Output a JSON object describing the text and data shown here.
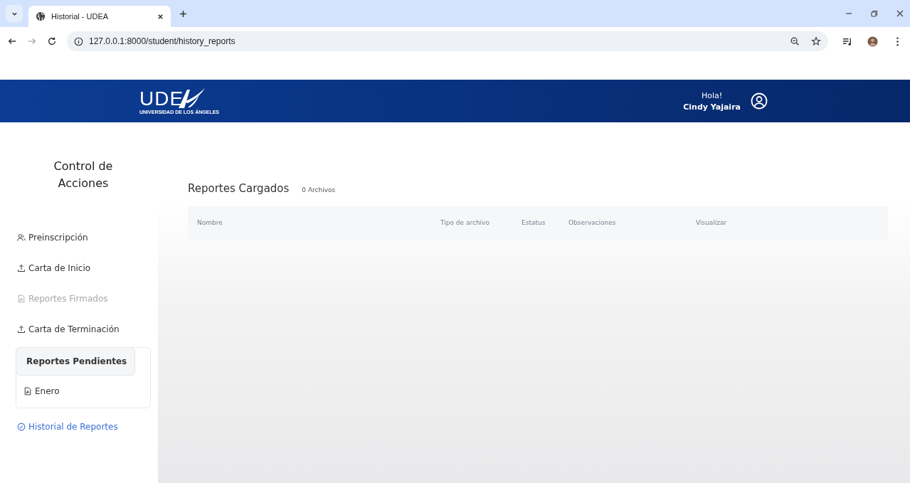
{
  "browser": {
    "tabs": [
      {
        "title": "Historial - UDEA",
        "selected": true
      }
    ],
    "address": "127.0.0.1:8000/student/history_reports"
  },
  "header": {
    "logo_text": "UDE",
    "logo_subtitle": "UNIVERSIDAD DE LOS ÁNGELES",
    "greeting": "Hola!",
    "user_name": "Cindy Yajaira"
  },
  "sidebar": {
    "title": "Control de Acciones",
    "items": [
      {
        "label": "Preinscripción",
        "kind": "link",
        "disabled": false,
        "selected": false
      },
      {
        "label": "Carta de Inicio",
        "kind": "link",
        "disabled": false,
        "selected": false
      },
      {
        "label": "Reportes Firmados",
        "kind": "link",
        "disabled": true,
        "selected": false
      },
      {
        "label": "Carta de Terminación",
        "kind": "link",
        "disabled": false,
        "selected": false
      },
      {
        "label": "Reportes Pendientes",
        "kind": "group",
        "children": [
          {
            "label": "Enero"
          }
        ]
      },
      {
        "label": "Historial de Reportes",
        "kind": "link",
        "disabled": false,
        "selected": true
      }
    ]
  },
  "content": {
    "title": "Reportes Cargados",
    "count": "0 Archivos",
    "table": {
      "columns": [
        "Nombre",
        "Tipo de archivo",
        "Estatus",
        "Observaciones",
        "Visualizar"
      ]
    }
  }
}
